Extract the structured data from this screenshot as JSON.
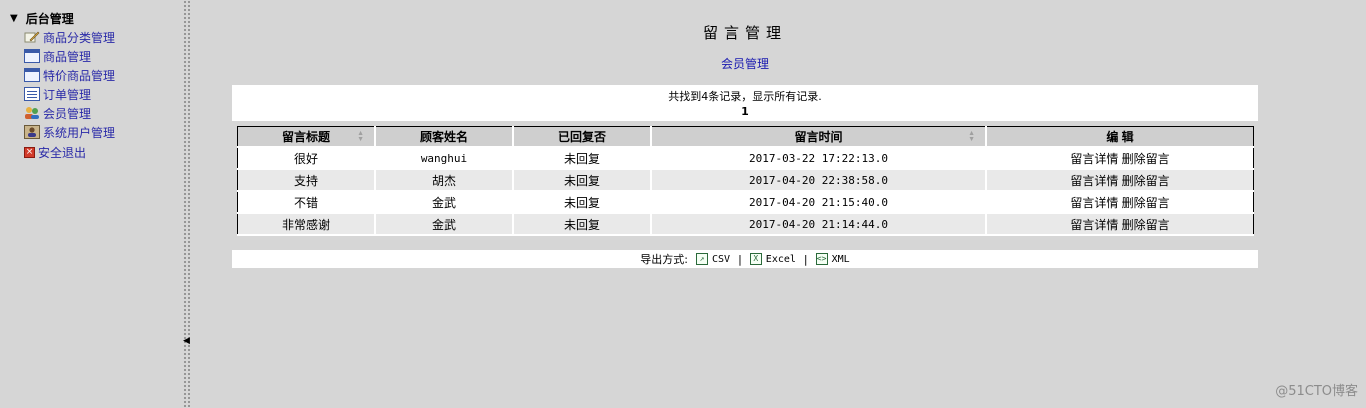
{
  "sidebar": {
    "root_label": "后台管理",
    "items": [
      {
        "label": "商品分类管理",
        "icon": "pencil-icon"
      },
      {
        "label": "商品管理",
        "icon": "window-icon"
      },
      {
        "label": "特价商品管理",
        "icon": "window-icon"
      },
      {
        "label": "订单管理",
        "icon": "list-icon"
      },
      {
        "label": "会员管理",
        "icon": "users-icon"
      },
      {
        "label": "系统用户管理",
        "icon": "user-icon"
      },
      {
        "label": "安全退出",
        "icon": "exit-icon"
      }
    ]
  },
  "main": {
    "title": "留言管理",
    "link": "会员管理",
    "summary": "共找到4条记录，显示所有记录.",
    "page": "1",
    "columns": [
      "留言标题",
      "顾客姓名",
      "已回复否",
      "留言时间",
      "编 辑"
    ],
    "rows": [
      {
        "title": "很好",
        "customer": "wanghui",
        "replied": "未回复",
        "time": "2017-03-22 17:22:13.0",
        "detail": "留言详情",
        "delete": "删除留言"
      },
      {
        "title": "支持",
        "customer": "胡杰",
        "replied": "未回复",
        "time": "2017-04-20 22:38:58.0",
        "detail": "留言详情",
        "delete": "删除留言"
      },
      {
        "title": "不错",
        "customer": "金武",
        "replied": "未回复",
        "time": "2017-04-20 21:15:40.0",
        "detail": "留言详情",
        "delete": "删除留言"
      },
      {
        "title": "非常感谢",
        "customer": "金武",
        "replied": "未回复",
        "time": "2017-04-20 21:14:44.0",
        "detail": "留言详情",
        "delete": "删除留言"
      }
    ],
    "export": {
      "label": "导出方式:",
      "csv": "CSV",
      "excel": "Excel",
      "xml": "XML",
      "separator": "|"
    }
  },
  "watermark": "@51CTO博客",
  "colors": {
    "background": "#d6d6d6",
    "link": "#2a2aa8",
    "header": "#cfcfcf",
    "row_alt": "#e9e9e9"
  }
}
